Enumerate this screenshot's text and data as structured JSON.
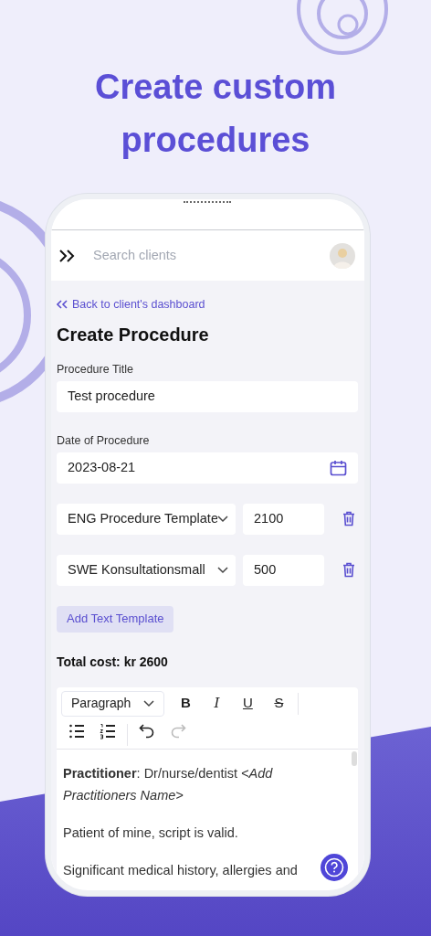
{
  "headline": "Create custom procedures",
  "app_bar": {
    "search": {
      "placeholder": "Search clients"
    }
  },
  "back_link": "Back to client's dashboard",
  "title": "Create Procedure",
  "fields": [
    {
      "label": "Procedure Title",
      "value": "Test procedure",
      "kind": "text"
    },
    {
      "label": "Date of Procedure",
      "value": "2023-08-21",
      "kind": "date"
    }
  ],
  "templates": [
    {
      "template": "ENG Procedure Template",
      "price": "2100"
    },
    {
      "template": "SWE Konsultationsmall",
      "price": "500"
    }
  ],
  "add_button": "Add Text Template",
  "total": "Total cost: kr 2600",
  "editor": {
    "block_style": "Paragraph",
    "toolbar": [
      {
        "kind": "bold",
        "label": "B",
        "disabled": false
      },
      {
        "kind": "italic",
        "label": "I",
        "disabled": false
      },
      {
        "kind": "underline",
        "label": "U",
        "disabled": false
      },
      {
        "kind": "strike",
        "label": "S",
        "disabled": false
      },
      {
        "kind": "bullets",
        "disabled": false
      },
      {
        "kind": "numbers",
        "disabled": false
      },
      {
        "kind": "undo",
        "disabled": false
      },
      {
        "kind": "redo",
        "disabled": true
      }
    ],
    "paragraphs": [
      "**Practitioner**: Dr/nurse/dentist *<Add Practitioners Name>*",
      "Patient of mine, script is valid.",
      "Significant medical history, allergies and"
    ]
  }
}
